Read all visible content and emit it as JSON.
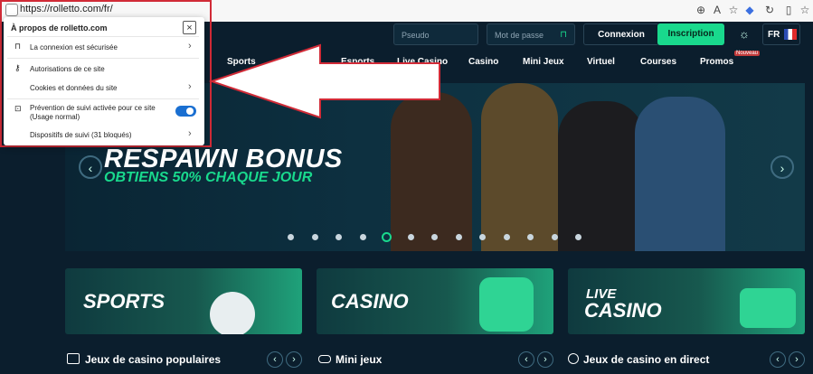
{
  "browser": {
    "url": "https://rolletto.com/fr/",
    "icons": [
      "zoom-icon",
      "read-aloud-icon",
      "favorites-star-icon",
      "extension-icon",
      "refresh-extension-icon",
      "sidebar-icon",
      "collections-icon"
    ]
  },
  "header": {
    "pseudo_placeholder": "Pseudo",
    "password_placeholder": "Mot de passe",
    "login_label": "Connexion",
    "signup_label": "Inscription",
    "language": "FR"
  },
  "nav": {
    "items": [
      "Sports",
      "Esports",
      "Live Casino",
      "Casino",
      "Mini Jeux",
      "Virtuel",
      "Courses",
      "Promos"
    ],
    "promo_badge": "Nouveau"
  },
  "banner": {
    "title": "RESPAWN BONUS",
    "subtitle": "OBTIENS 50% CHAQUE JOUR",
    "active_slide": 5,
    "slide_count": 13
  },
  "cards": [
    {
      "label": "SPORTS"
    },
    {
      "label": "CASINO"
    },
    {
      "label_line1": "LIVE",
      "label_line2": "CASINO"
    }
  ],
  "sections": [
    {
      "title": "Jeux de casino populaires"
    },
    {
      "title": "Mini jeux"
    },
    {
      "title": "Jeux de casino en direct"
    }
  ],
  "popup": {
    "title": "À propos de rolletto.com",
    "rows": [
      {
        "label": "La connexion est sécurisée"
      },
      {
        "label": "Autorisations de ce site"
      },
      {
        "label": "Cookies et données du site"
      },
      {
        "label": "Prévention de suivi activée pour ce site (Usage normal)"
      },
      {
        "label": "Dispositifs de suivi (31 bloqués)"
      }
    ],
    "tracking_prevention_enabled": true
  },
  "colors": {
    "accent_green": "#19d98d",
    "background": "#0b1e2d",
    "annotation_red": "#d12b37",
    "toggle_blue": "#1a6fd1"
  }
}
